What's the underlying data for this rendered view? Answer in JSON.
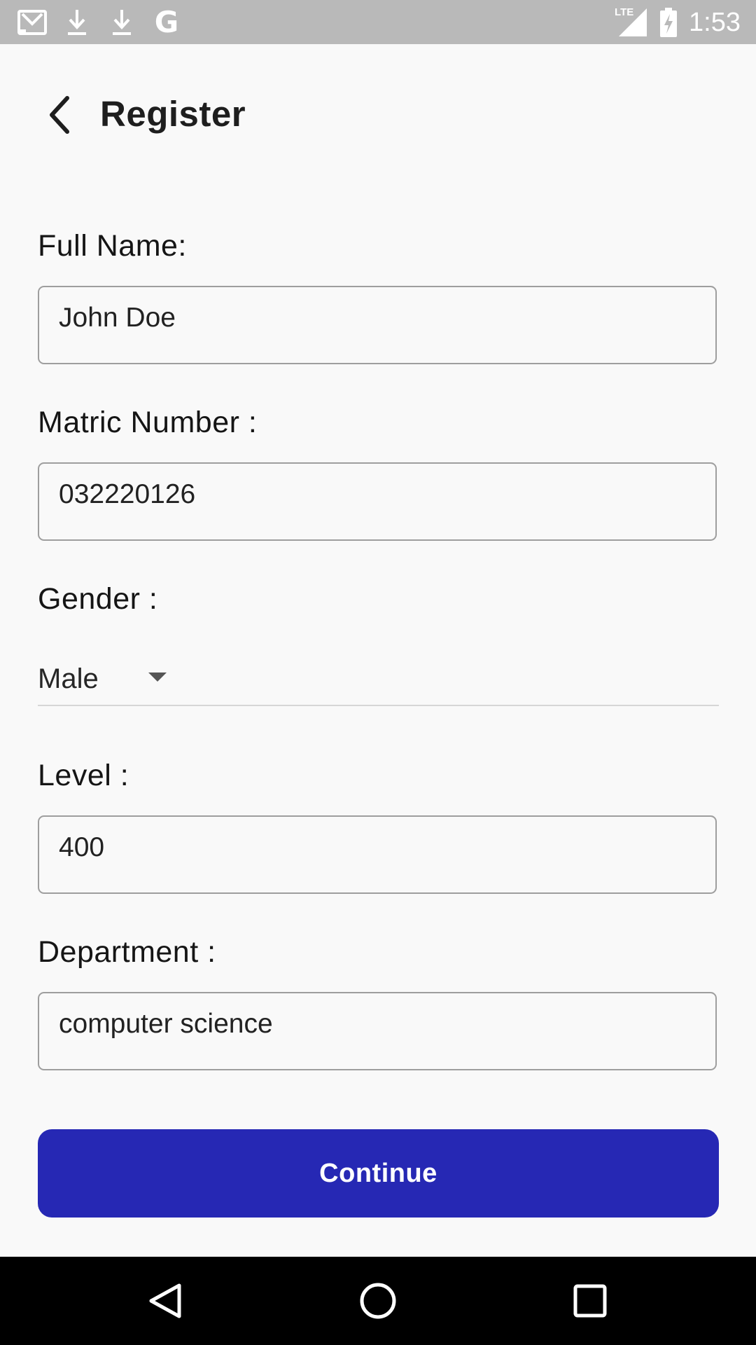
{
  "status_bar": {
    "time": "1:53",
    "network": "LTE",
    "icons": [
      "gmail-icon",
      "download-icon",
      "download-icon",
      "google-icon",
      "lte-signal-icon",
      "battery-charging-icon"
    ],
    "google_letter": "G"
  },
  "header": {
    "title": "Register",
    "back_icon": "back-arrow-icon"
  },
  "form": {
    "full_name": {
      "label": "Full Name:",
      "value": "John Doe"
    },
    "matric_number": {
      "label": "Matric Number :",
      "value": "032220126"
    },
    "gender": {
      "label": "Gender :",
      "selected": "Male"
    },
    "level": {
      "label": "Level :",
      "value": "400"
    },
    "department": {
      "label": "Department :",
      "value": "computer science"
    }
  },
  "continue_label": "Continue",
  "colors": {
    "primary": "#2628b4",
    "status_bar": "#b9b9b9",
    "background": "#f9f9f9",
    "nav_bar": "#000000"
  },
  "nav": {
    "back": "nav-back-icon",
    "home": "nav-home-icon",
    "recents": "nav-recents-icon"
  }
}
